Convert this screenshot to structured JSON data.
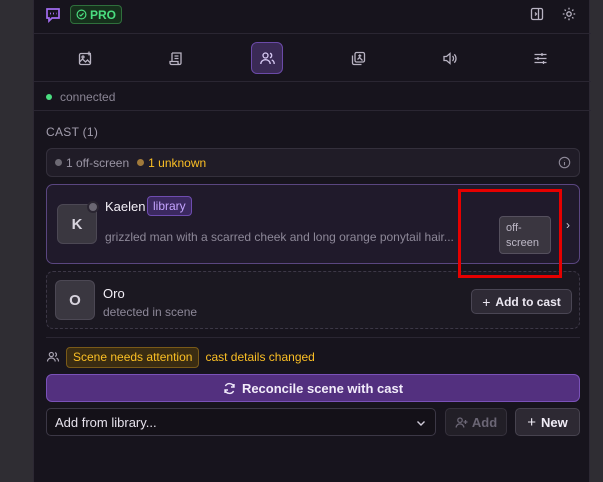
{
  "header": {
    "logo_icon": "chat-logo-icon",
    "badge_label": "PRO",
    "actions": [
      "panel-toggle-icon",
      "gear-icon"
    ]
  },
  "tabs": [
    {
      "icon": "image-add-icon",
      "active": false
    },
    {
      "icon": "scroll-icon",
      "active": false
    },
    {
      "icon": "users-icon",
      "active": true
    },
    {
      "icon": "gallery-add-icon",
      "active": false
    },
    {
      "icon": "volume-icon",
      "active": false
    },
    {
      "icon": "sliders-icon",
      "active": false
    }
  ],
  "status": {
    "text": "connected",
    "color": "#4ade80"
  },
  "cast": {
    "title": "CAST (1)",
    "summary": {
      "offscreen": "1 off-screen",
      "unknown": "1 unknown"
    },
    "cards": [
      {
        "initial": "K",
        "name": "Kaelen",
        "badge": "library",
        "description": "grizzled man with a scarred cheek and long orange ponytail hair...",
        "state_badge": "off-screen",
        "chevron": "›"
      },
      {
        "initial": "O",
        "name": "Oro",
        "description": "detected in scene",
        "action_label": "Add to cast"
      }
    ]
  },
  "attention": {
    "badge": "Scene needs attention",
    "text": "cast details changed"
  },
  "reconcile_label": "Reconcile scene with cast",
  "library": {
    "select_value": "Add from library...",
    "add_label": "Add",
    "new_label": "New"
  },
  "colors": {
    "accent": "#7a52b8",
    "warning": "#fbbf24",
    "success": "#4ade80",
    "highlight": "#e60000"
  }
}
